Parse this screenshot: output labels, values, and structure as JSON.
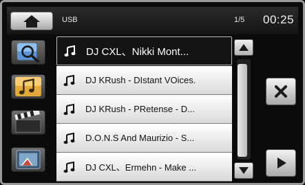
{
  "header": {
    "source": "USB",
    "page": "1/5",
    "clock": "00:25",
    "home_icon": "home-icon"
  },
  "categories": [
    {
      "id": "search",
      "icon": "search-icon"
    },
    {
      "id": "music",
      "icon": "music-note-icon"
    },
    {
      "id": "video",
      "icon": "clapperboard-icon"
    },
    {
      "id": "photo",
      "icon": "photo-icon"
    }
  ],
  "tracks": [
    {
      "title": "DJ CXL、Nikki Mont...",
      "selected": true
    },
    {
      "title": "DJ KRush - DIstant VOices.",
      "selected": false
    },
    {
      "title": "DJ KRush - PRetense - D...",
      "selected": false
    },
    {
      "title": "D.O.N.S And Maurizio - S...",
      "selected": false
    },
    {
      "title": "DJ CXL、Ermehn - Make ...",
      "selected": false
    }
  ],
  "scrollbar": {
    "up_icon": "arrow-up-icon",
    "down_icon": "arrow-down-icon"
  },
  "actions": {
    "close_icon": "close-icon",
    "play_icon": "play-icon"
  },
  "colors": {
    "background": "#0b0b0b",
    "row_light": "#ffffff",
    "row_selected": "#141414",
    "button_light": "#f4f4f4",
    "button_dark": "#a8a8a8"
  }
}
